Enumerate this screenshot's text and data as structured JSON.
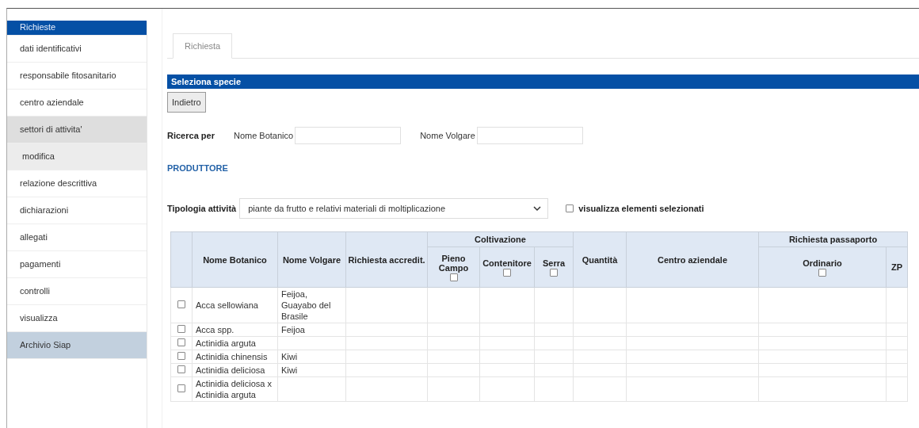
{
  "sidebar": {
    "items": [
      {
        "label": "Richieste",
        "selected": true
      },
      {
        "label": "dati identificativi",
        "selected": false
      },
      {
        "label": "responsabile fitosanitario",
        "selected": false
      },
      {
        "label": "centro aziendale",
        "selected": false
      },
      {
        "label": "settori di attivita'",
        "selected": false,
        "expanded": true,
        "children": [
          {
            "label": "modifica",
            "selected": false
          }
        ]
      },
      {
        "label": "relazione descrittiva",
        "selected": false
      },
      {
        "label": "dichiarazioni",
        "selected": false
      },
      {
        "label": "allegati",
        "selected": false
      },
      {
        "label": "pagamenti",
        "selected": false
      },
      {
        "label": "controlli",
        "selected": false
      },
      {
        "label": "visualizza",
        "selected": false
      },
      {
        "label": "Archivio Siap",
        "selected": false,
        "kind": "archive"
      }
    ]
  },
  "tabs": [
    {
      "label": "Richiesta",
      "selected": true
    }
  ],
  "section_title": "Seleziona specie",
  "back_button": "Indietro",
  "search": {
    "label": "Ricerca per",
    "fields": [
      {
        "label": "Nome Botanico"
      },
      {
        "label": "Nome Volgare"
      }
    ]
  },
  "role_heading": "PRODUTTORE",
  "activity": {
    "label": "Tipologia attività",
    "value": "piante da frutto e relativi materiali di moltiplicazione",
    "show_selected": {
      "label": "visualizza elementi selezionati",
      "checked": false
    }
  },
  "table": {
    "columns": [
      {
        "label": "Nome Botanico"
      },
      {
        "label": "Nome Volgare"
      },
      {
        "label": "Richiesta accredit."
      },
      {
        "label": "Coltivazione",
        "children": [
          {
            "label": "Pieno Campo",
            "checked": false
          },
          {
            "label": "Contenitore",
            "checked": false
          },
          {
            "label": "Serra",
            "checked": false
          }
        ]
      },
      {
        "label": "Quantità"
      },
      {
        "label": "Centro aziendale"
      },
      {
        "label": "Richiesta passaporto",
        "children": [
          {
            "label": "Ordinario",
            "checked": false
          },
          {
            "label": "ZP"
          }
        ]
      }
    ],
    "rows": [
      {
        "checked": false,
        "cells": [
          "Acca sellowiana",
          "Feijoa, Guayabo del Brasile"
        ]
      },
      {
        "checked": false,
        "cells": [
          "Acca spp.",
          "Feijoa"
        ]
      },
      {
        "checked": false,
        "cells": [
          "Actinidia arguta"
        ]
      },
      {
        "checked": false,
        "cells": [
          "Actinidia chinensis",
          "Kiwi"
        ]
      },
      {
        "checked": false,
        "cells": [
          "Actinidia deliciosa",
          "Kiwi"
        ]
      },
      {
        "checked": false,
        "cells": [
          "Actinidia deliciosa x Actinidia arguta"
        ]
      }
    ]
  }
}
